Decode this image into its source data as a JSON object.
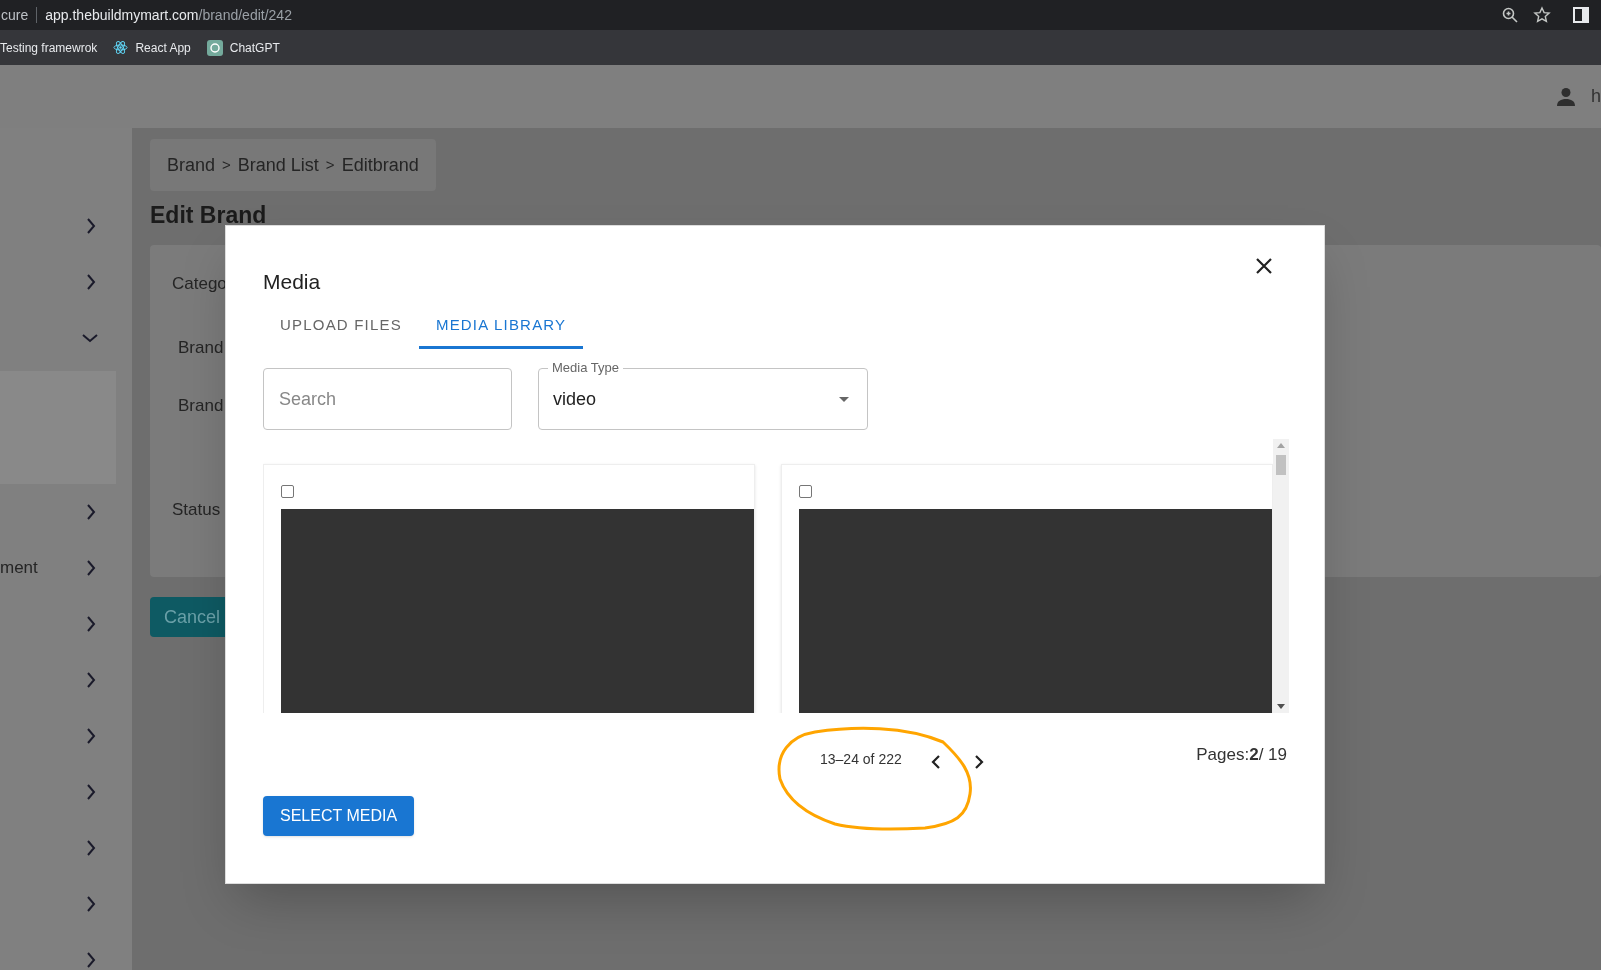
{
  "browser": {
    "url_prefix": "cure",
    "url_host": "app.thebuildmymart.com",
    "url_path": "/brand/edit/242"
  },
  "bookmarks": [
    {
      "label": "Testing framewrok",
      "kind": "plain"
    },
    {
      "label": "React App",
      "kind": "react"
    },
    {
      "label": "ChatGPT",
      "kind": "chat"
    }
  ],
  "header": {
    "user_text": "h"
  },
  "sidebar": {
    "items": [
      {
        "expanded": false
      },
      {
        "expanded": false
      },
      {
        "expanded": true,
        "children": [
          {
            "selected": true
          }
        ]
      },
      {
        "expanded": false
      },
      {
        "label": "ment",
        "expanded": false
      },
      {
        "expanded": false
      },
      {
        "expanded": false
      },
      {
        "expanded": false
      },
      {
        "expanded": false
      },
      {
        "expanded": false
      },
      {
        "expanded": false
      },
      {
        "expanded": false
      }
    ]
  },
  "breadcrumb": [
    {
      "label": "Brand",
      "kind": "link"
    },
    {
      "label": ">",
      "kind": "separator"
    },
    {
      "label": "Brand List",
      "kind": "link"
    },
    {
      "label": ">",
      "kind": "separator"
    },
    {
      "label": "Editbrand",
      "kind": "link"
    }
  ],
  "page_title": "Edit Brand",
  "form": {
    "labels": [
      "Catego",
      "Brand",
      "Brand",
      "Status"
    ]
  },
  "cancel_button": "Cancel",
  "modal": {
    "title": "Media",
    "tabs": [
      {
        "label": "UPLOAD FILES",
        "selected": false
      },
      {
        "label": "MEDIA LIBRARY",
        "selected": true
      }
    ],
    "search": {
      "placeholder": "Search"
    },
    "media_type": {
      "label": "Media Type",
      "value": "video"
    },
    "media_items": [
      {
        "checked": false,
        "kind": "video"
      },
      {
        "checked": false,
        "kind": "video"
      }
    ],
    "pagination": {
      "range": "13–24 of 222",
      "pages": "Pages:**2**/ 19"
    },
    "select_button": "SELECT MEDIA"
  },
  "annotations": [
    {
      "kind": "circle"
    }
  ]
}
